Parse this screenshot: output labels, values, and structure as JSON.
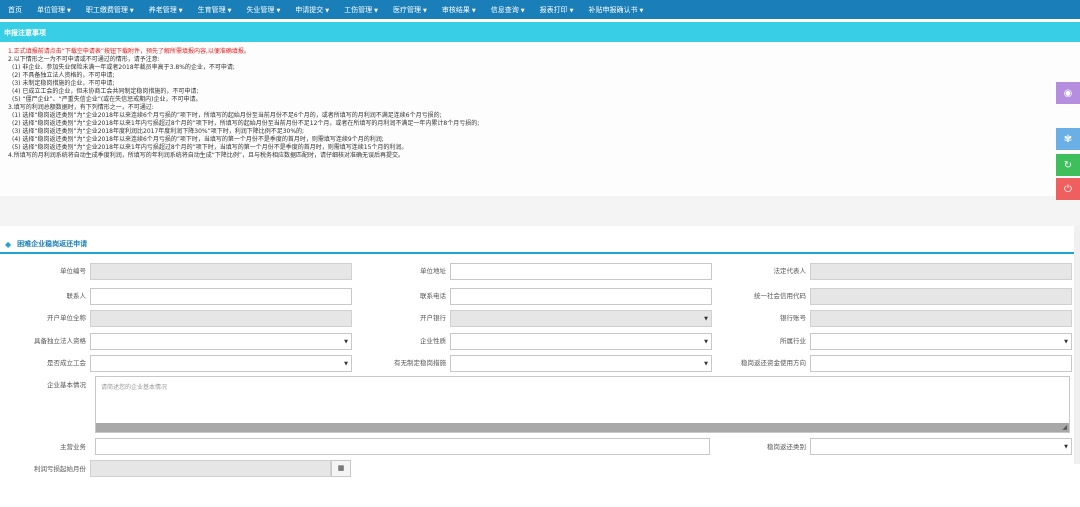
{
  "nav": [
    {
      "label": "首页",
      "dropdown": false
    },
    {
      "label": "单位管理",
      "dropdown": true
    },
    {
      "label": "职工缴费管理",
      "dropdown": true
    },
    {
      "label": "养老管理",
      "dropdown": true
    },
    {
      "label": "生育管理",
      "dropdown": true
    },
    {
      "label": "失业管理",
      "dropdown": true
    },
    {
      "label": "申请提交",
      "dropdown": true
    },
    {
      "label": "工伤管理",
      "dropdown": true
    },
    {
      "label": "医疗管理",
      "dropdown": true
    },
    {
      "label": "审核结果",
      "dropdown": true
    },
    {
      "label": "信息查询",
      "dropdown": true
    },
    {
      "label": "报表打印",
      "dropdown": true
    },
    {
      "label": "补贴申报确认书",
      "dropdown": true
    }
  ],
  "caret": "▼",
  "notice": {
    "title": "申报注意事项",
    "lines": [
      "1.正式填报前请点击“下载空申请表”按钮下载附件，预先了解所需填报内容,以便准确填报。",
      "2.以下情形之一为不可申请或不可通过的情形，请予注意:",
      "(1) 非企业、参加失业保险未满一年或者2018年裁员率高于3.8%的企业，不可申请;",
      "(2) 不具备独立法人资格的，不可申请;",
      "(3) 未制定稳岗措施的企业，不可申请;",
      "(4) 已成立工会的企业，但未协商工会共同制定稳岗措施的，不可申请;",
      "(5) “僵尸企业”、“严重失信企业”(或在失信惩戒期内)企业，不可申请。",
      "3.填写的利润总额数据时，有下列情形之一，不可通过:",
      "(1) 选择“稳岗返还类别”为“企业2018年以来连续6个月亏损的”项下时，所填写的起始月份至当前月份不足6个月的，或者所填写的月利润不满足连续6个月亏损的;",
      "(2) 选择“稳岗返还类别”为“企业2018年以来1年内亏损超过8个月的”项下时，所填写的起始月份至当前月份不足12个月，或者在所填写的月利润不满足一年内累计8个月亏损的;",
      "(3) 选择“稳岗返还类别”为“企业2018年度利润比2017年度利润下降30%”项下时，利润下降比例不足30%的;",
      "(4) 选择“稳岗返还类别”为“企业2018年以来连续6个月亏损的”项下时，当填写的第一个月份不是季度的首月时，则需填写连续9个月的利润;",
      "(5) 选择“稳岗返还类别”为“企业2018年以来1年内亏损超过8个月的”项下时，当填写的第一个月份不是季度的首月时，则需填写连续15个月的利润。",
      "4.所填写的月利润系统将自动生成季度利润，所填写的年利润系统将自动生成“下降比例”，且与税务相应数据匹配时，请仔细核对准确无误后再提交。"
    ]
  },
  "section_title": "困难企业稳岗返还申请",
  "form": {
    "unit_code": "单位编号",
    "unit_address": "单位地址",
    "legal_rep": "法定代表人",
    "contact": "联系人",
    "phone": "联系电话",
    "credit_code": "统一社会信用代码",
    "account_name": "开户单位全称",
    "bank": "开户银行",
    "bank_account": "银行账号",
    "legal_entity": "具备独立法人资格",
    "enterprise_nature": "企业性质",
    "industry": "所属行业",
    "union": "是否成立工会",
    "measures": "有无制定稳岗措施",
    "fund_usage": "稳岗返还资金使用方向",
    "basic_info": "企业基本情况",
    "basic_info_placeholder": "请简述您的企业基本情况",
    "main_business": "主营业务",
    "refund_category": "稳岗返还类别",
    "profit_start_month": "利润亏损起始月份"
  },
  "icons": {
    "calendar": "▦",
    "eye": "◉",
    "tree": "✾",
    "refresh": "↻",
    "power": "⏻",
    "diamond": "◆",
    "resize": "◢"
  },
  "colors": {
    "nav": "#1a7fb8",
    "notice_header": "#38cfe6",
    "warning_text": "#e21a1a",
    "section_accent": "#22a3d6"
  }
}
